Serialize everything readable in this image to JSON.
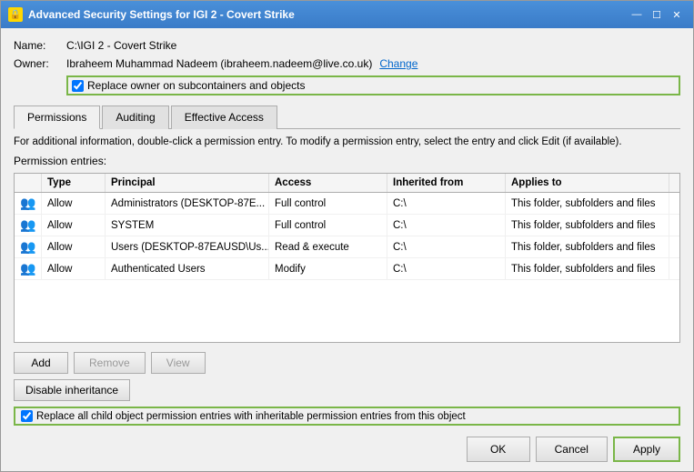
{
  "window": {
    "title": "Advanced Security Settings for IGI 2 - Covert Strike",
    "icon": "🔒"
  },
  "title_controls": {
    "minimize": "—",
    "maximize": "☐",
    "close": "✕"
  },
  "info": {
    "name_label": "Name:",
    "name_value": "C:\\IGI 2 - Covert Strike",
    "owner_label": "Owner:",
    "owner_value": "Ibraheem Muhammad Nadeem (ibraheem.nadeem@live.co.uk)",
    "change_link": "Change",
    "replace_checkbox_label": "Replace owner on subcontainers and objects",
    "replace_checkbox_checked": true
  },
  "tabs": [
    {
      "id": "permissions",
      "label": "Permissions",
      "active": true
    },
    {
      "id": "auditing",
      "label": "Auditing",
      "active": false
    },
    {
      "id": "effective_access",
      "label": "Effective Access",
      "active": false
    }
  ],
  "description": "For additional information, double-click a permission entry. To modify a permission entry, select the entry and click Edit (if available).",
  "entries_label": "Permission entries:",
  "table": {
    "headers": [
      "",
      "Type",
      "Principal",
      "Access",
      "Inherited from",
      "Applies to"
    ],
    "rows": [
      {
        "icon": "👥",
        "type": "Allow",
        "principal": "Administrators (DESKTOP-87E...",
        "access": "Full control",
        "inherited": "C:\\",
        "applies_to": "This folder, subfolders and files"
      },
      {
        "icon": "👥",
        "type": "Allow",
        "principal": "SYSTEM",
        "access": "Full control",
        "inherited": "C:\\",
        "applies_to": "This folder, subfolders and files"
      },
      {
        "icon": "👥",
        "type": "Allow",
        "principal": "Users (DESKTOP-87EAUSD\\Us...",
        "access": "Read & execute",
        "inherited": "C:\\",
        "applies_to": "This folder, subfolders and files"
      },
      {
        "icon": "👥",
        "type": "Allow",
        "principal": "Authenticated Users",
        "access": "Modify",
        "inherited": "C:\\",
        "applies_to": "This folder, subfolders and files"
      }
    ]
  },
  "buttons": {
    "add": "Add",
    "remove": "Remove",
    "view": "View",
    "disable_inheritance": "Disable inheritance"
  },
  "replace_child_label": "Replace all child object permission entries with inheritable permission entries from this object",
  "replace_child_checked": true,
  "footer": {
    "ok": "OK",
    "cancel": "Cancel",
    "apply": "Apply"
  }
}
